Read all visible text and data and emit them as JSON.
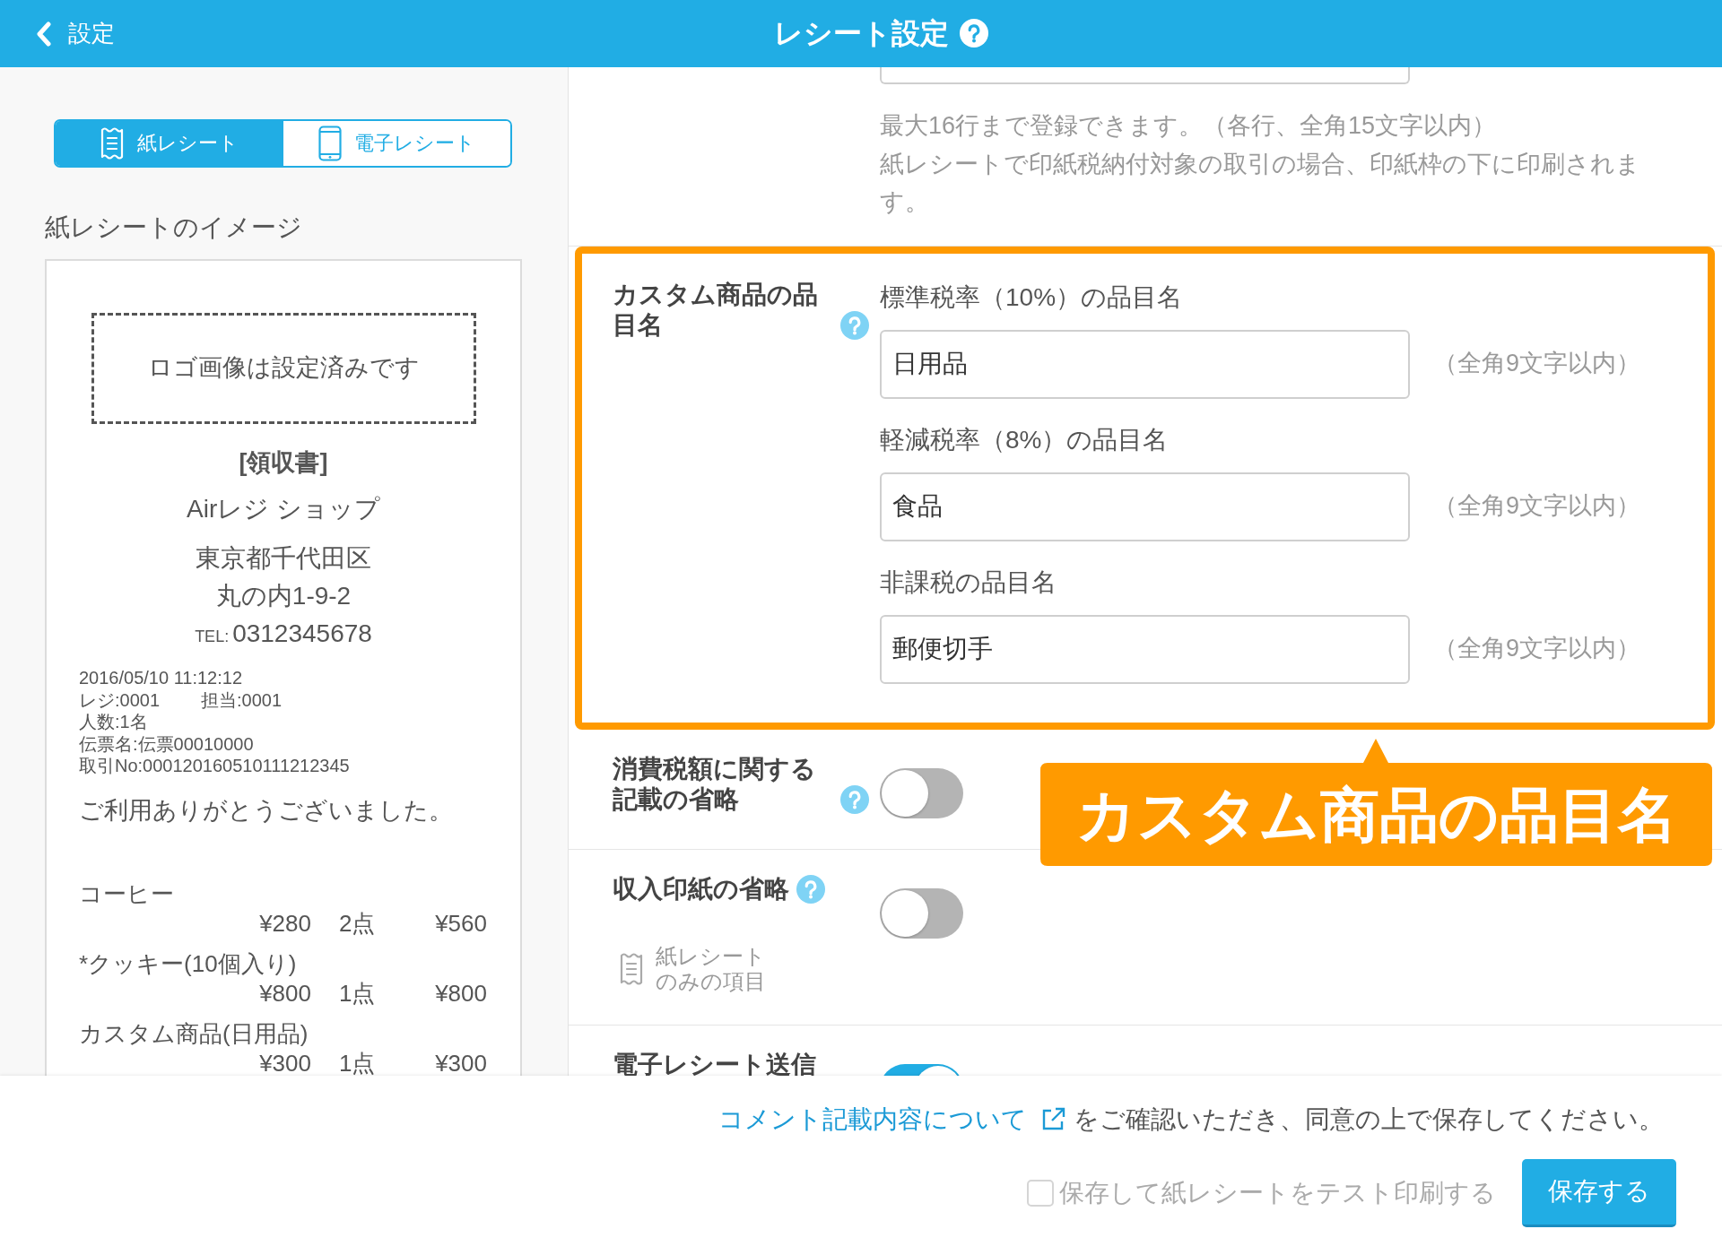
{
  "header": {
    "back_label": "設定",
    "title": "レシート設定",
    "title_help": true
  },
  "receipt_tabs": [
    {
      "label": "紙レシート",
      "kind": "paper",
      "selected": true
    },
    {
      "label": "電子レシート",
      "kind": "electronic",
      "selected": false
    }
  ],
  "preview": {
    "title": "紙レシートのイメージ",
    "logo_text": "ロゴ画像は設定済みです",
    "heading": "[領収書]",
    "shop_name": "Airレジ ショップ",
    "address": [
      "東京都千代田区",
      "丸の内1-9-2"
    ],
    "tel_label": "TEL:",
    "tel": "0312345678",
    "details": [
      [
        "2016/05/10 11:12:12"
      ],
      [
        "レジ:0001",
        "担当:0001"
      ],
      [
        "人数:1名"
      ],
      [
        "伝票名:伝票00010000"
      ],
      [
        "取引No:000120160510111212345"
      ]
    ],
    "thanks": "ご利用ありがとうございました。",
    "items": [
      {
        "name": "コーヒー",
        "price": "¥280",
        "quantity": "2点",
        "total": "¥560"
      },
      {
        "name": "*クッキー(10個入り)",
        "price": "¥800",
        "quantity": "1点",
        "total": "¥800"
      },
      {
        "name": "カスタム商品(日用品)",
        "price": "¥300",
        "quantity": "1点",
        "total": "¥300"
      }
    ]
  },
  "settings": [
    {
      "kind": "multiline_field",
      "highlighted": false,
      "notes": [
        "最大16行まで登録できます。（各行、全角15文字以内）",
        "紙レシートで印紙税納付対象の取引の場合、印紙枠の下に印刷されます。"
      ]
    },
    {
      "kind": "fields",
      "label": "カスタム商品の品目名",
      "help": true,
      "highlighted": true,
      "fields": [
        {
          "label": "標準税率（10%）の品目名",
          "value": "日用品",
          "limit": "（全角9文字以内）"
        },
        {
          "label": "軽減税率（8%）の品目名",
          "value": "食品",
          "limit": "（全角9文字以内）"
        },
        {
          "label": "非課税の品目名",
          "value": "郵便切手",
          "limit": "（全角9文字以内）"
        }
      ]
    },
    {
      "kind": "toggle",
      "label": "消費税額に関する記載の省略",
      "help": true,
      "highlighted": false,
      "on": false
    },
    {
      "kind": "toggle",
      "label": "収入印紙の省略",
      "help": true,
      "highlighted": false,
      "on": false,
      "paper_only": "紙レシートのみの項目"
    },
    {
      "kind": "toggle",
      "label": "電子レシート送信",
      "highlighted": false,
      "on": true
    }
  ],
  "callout": {
    "text": "カスタム商品の品目名"
  },
  "footer": {
    "link": "コメント記載内容について",
    "message": "をご確認いただき、同意の上で保存してください。",
    "test_print": {
      "label": "保存して紙レシートをテスト印刷する",
      "checked": false,
      "disabled": true
    },
    "save_label": "保存する"
  }
}
